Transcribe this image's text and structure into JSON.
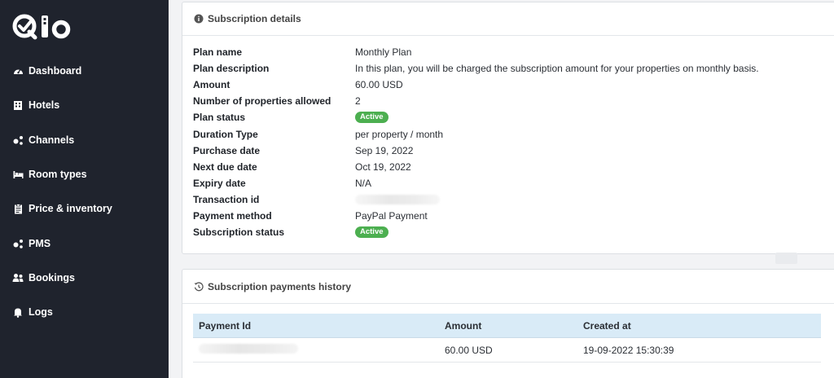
{
  "sidebar": {
    "logo_text": "Qlo",
    "items": [
      {
        "label": "Dashboard",
        "icon": "dashboard-icon"
      },
      {
        "label": "Hotels",
        "icon": "building-icon"
      },
      {
        "label": "Channels",
        "icon": "share-nodes-icon"
      },
      {
        "label": "Room types",
        "icon": "bed-icon"
      },
      {
        "label": "Price & inventory",
        "icon": "clipboard-icon"
      },
      {
        "label": "PMS",
        "icon": "share-nodes-icon"
      },
      {
        "label": "Bookings",
        "icon": "users-icon"
      },
      {
        "label": "Logs",
        "icon": "bell-icon"
      }
    ]
  },
  "details": {
    "title": "Subscription details",
    "icon": "info-icon",
    "rows": [
      {
        "label": "Plan name",
        "value": "Monthly Plan"
      },
      {
        "label": "Plan description",
        "value": "In this plan, you will be charged the subscription amount for your properties on monthly basis."
      },
      {
        "label": "Amount",
        "value": "60.00 USD"
      },
      {
        "label": "Number of properties allowed",
        "value": "2"
      },
      {
        "label": "Plan status",
        "badge": "Active"
      },
      {
        "label": "Duration Type",
        "value": "per property / month"
      },
      {
        "label": "Purchase date",
        "value": "Sep 19, 2022"
      },
      {
        "label": "Next due date",
        "value": "Oct 19, 2022"
      },
      {
        "label": "Expiry date",
        "value": "N/A"
      },
      {
        "label": "Transaction id",
        "value": ""
      },
      {
        "label": "Payment method",
        "value": "PayPal Payment"
      },
      {
        "label": "Subscription status",
        "badge": "Active"
      }
    ]
  },
  "history": {
    "title": "Subscription payments history",
    "icon": "history-icon",
    "columns": [
      "Payment Id",
      "Amount",
      "Created at"
    ],
    "rows": [
      {
        "payment_id": "",
        "amount": "60.00 USD",
        "created_at": "19-09-2022 15:30:39"
      }
    ]
  },
  "colors": {
    "sidebar_bg": "#1f232d",
    "badge_green": "#4caf50",
    "table_header_bg": "#d9ebf7"
  }
}
